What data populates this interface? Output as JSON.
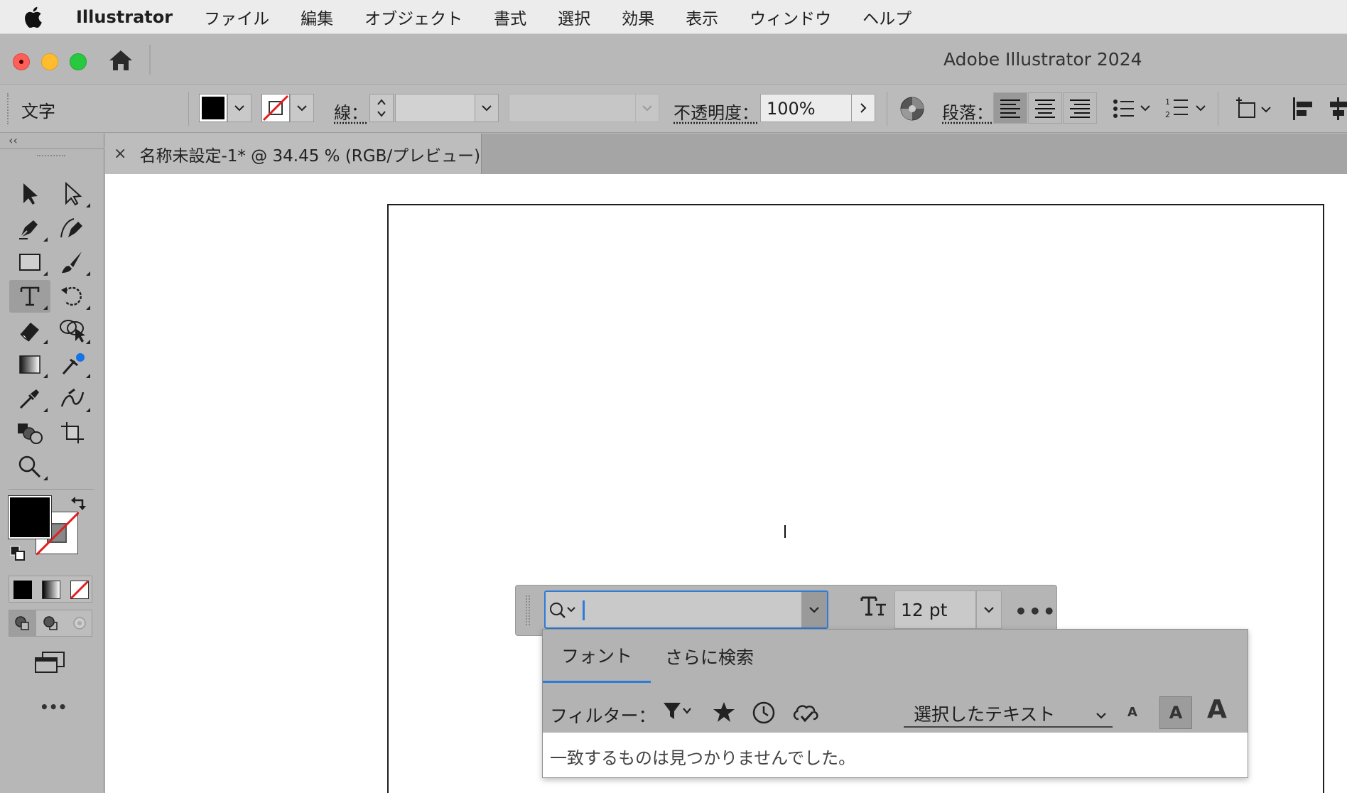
{
  "menubar": {
    "app_name": "Illustrator",
    "items": [
      "ファイル",
      "編集",
      "オブジェクト",
      "書式",
      "選択",
      "効果",
      "表示",
      "ウィンドウ",
      "ヘルプ"
    ]
  },
  "window": {
    "title": "Adobe Illustrator 2024"
  },
  "controlbar": {
    "type_label": "文字",
    "stroke_label": "線：",
    "opacity_label": "不透明度：",
    "opacity_value": "100%",
    "paragraph_label": "段落："
  },
  "tab": {
    "close": "×",
    "title": "名称未設定-1* @ 34.45 % (RGB/プレビュー)"
  },
  "tools": {
    "collapse": "‹‹",
    "more": "•••"
  },
  "ctx_bar": {
    "font_search_value": "",
    "font_size": "12 pt",
    "more": "•••"
  },
  "font_panel": {
    "tabs": [
      "フォント",
      "さらに検索"
    ],
    "filter_label": "フィルター：",
    "selected_text_option": "選択したテキスト",
    "size_small": "A",
    "size_mid": "A",
    "size_large": "A",
    "no_results": "一致するものは見つかりませんでした。"
  },
  "colors": {
    "accent": "#2f7bd6",
    "fill": "#000000",
    "none_slash": "#e02020"
  }
}
